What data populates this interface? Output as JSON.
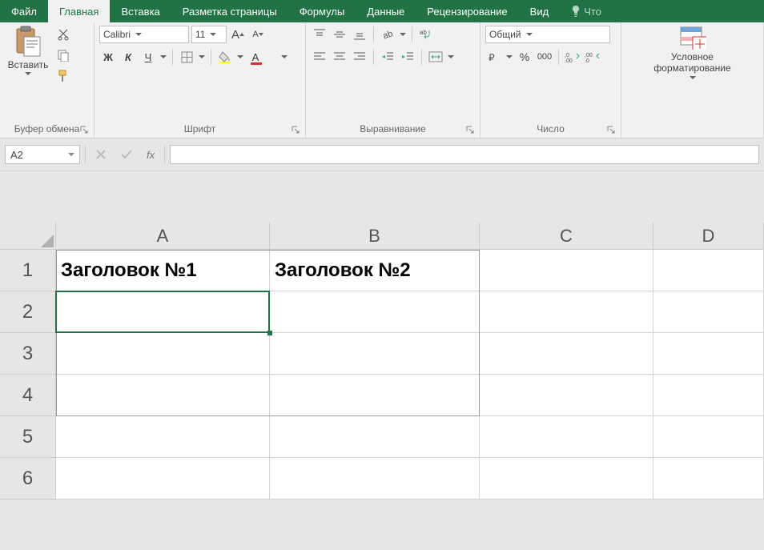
{
  "tabs": {
    "file": "Файл",
    "home": "Главная",
    "insert": "Вставка",
    "layout": "Разметка страницы",
    "formulas": "Формулы",
    "data": "Данные",
    "review": "Рецензирование",
    "view": "Вид",
    "tell": "Что"
  },
  "ribbon": {
    "clipboard": {
      "paste": "Вставить",
      "label": "Буфер обмена"
    },
    "font": {
      "name": "Calibri",
      "size": "11",
      "bold_glyph": "Ж",
      "italic_glyph": "К",
      "underline_glyph": "Ч",
      "label": "Шрифт"
    },
    "alignment": {
      "label": "Выравнивание"
    },
    "number": {
      "format": "Общий",
      "label": "Число"
    },
    "styles": {
      "cond_format": "Условное форматирование"
    }
  },
  "formula_bar": {
    "name_box": "A2",
    "fx": "fx",
    "formula": ""
  },
  "grid": {
    "columns": [
      "A",
      "B",
      "C",
      "D"
    ],
    "rows": [
      "1",
      "2",
      "3",
      "4",
      "5",
      "6"
    ],
    "cells": {
      "A1": "Заголовок №1",
      "B1": "Заголовок №2"
    },
    "active_cell": "A2"
  },
  "chart_data": {
    "type": "table",
    "columns": [
      "A",
      "B"
    ],
    "rows": [
      {
        "A": "Заголовок №1",
        "B": "Заголовок №2"
      },
      {
        "A": "",
        "B": ""
      },
      {
        "A": "",
        "B": ""
      },
      {
        "A": "",
        "B": ""
      }
    ],
    "active_cell": "A2",
    "bordered_range": "A1:B4"
  }
}
